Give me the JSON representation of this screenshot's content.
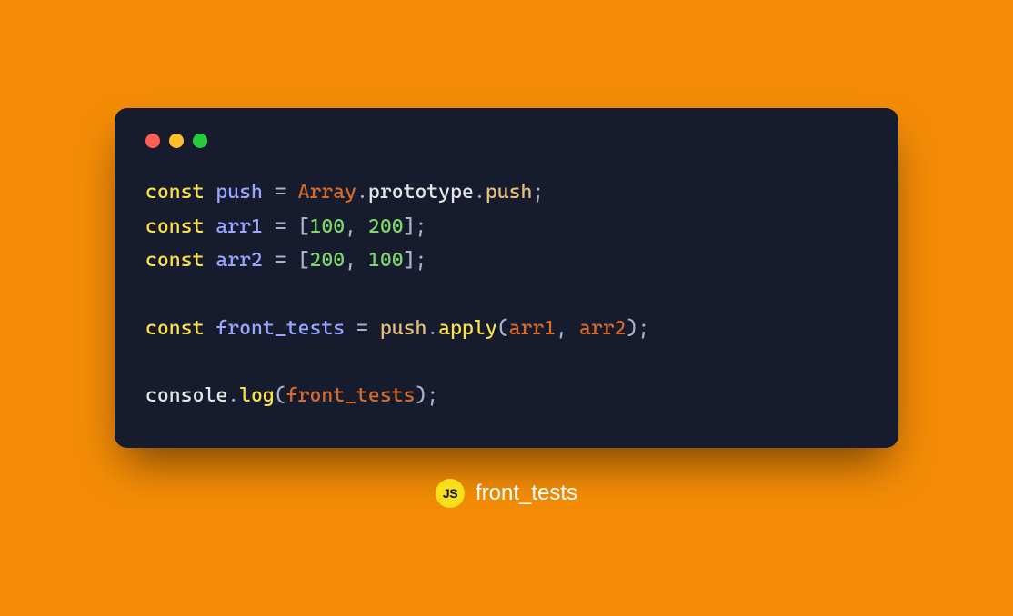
{
  "colors": {
    "background": "#f48c06",
    "window_bg": "#161b2e",
    "traffic_red": "#ff5f56",
    "traffic_yellow": "#ffbd2e",
    "traffic_green": "#27c93f",
    "js_badge_bg": "#f7df1e"
  },
  "footer": {
    "badge_text": "JS",
    "label": "front_tests"
  },
  "code": {
    "line1": {
      "kw": "const",
      "name": "push",
      "eq": " = ",
      "cls": "Array",
      "dot1": ".",
      "proto": "prototype",
      "dot2": ".",
      "push": "push",
      "semi": ";"
    },
    "line2": {
      "kw": "const",
      "name": "arr1",
      "eq": " = ",
      "lb": "[",
      "n1": "100",
      "comma": ", ",
      "n2": "200",
      "rb": "]",
      "semi": ";"
    },
    "line3": {
      "kw": "const",
      "name": "arr2",
      "eq": " = ",
      "lb": "[",
      "n1": "200",
      "comma": ", ",
      "n2": "100",
      "rb": "]",
      "semi": ";"
    },
    "line5": {
      "kw": "const",
      "name": "front_tests",
      "eq": " = ",
      "callee": "push",
      "dot": ".",
      "apply": "apply",
      "lp": "(",
      "arg1": "arr1",
      "comma": ", ",
      "arg2": "arr2",
      "rp": ")",
      "semi": ";"
    },
    "line7": {
      "obj": "console",
      "dot": ".",
      "log": "log",
      "lp": "(",
      "arg": "front_tests",
      "rp": ")",
      "semi": ";"
    }
  }
}
